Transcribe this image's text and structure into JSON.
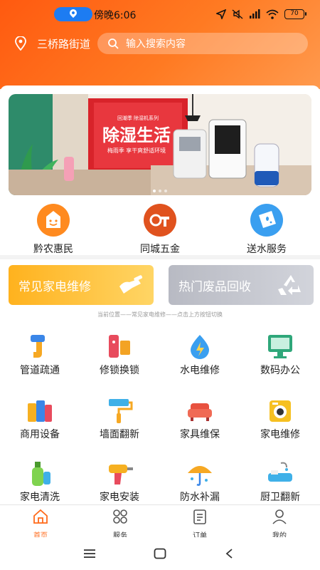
{
  "status": {
    "time": "傍晚6:06",
    "battery": "70"
  },
  "header": {
    "location": "三桥路街道",
    "search_placeholder": "输入搜索内容"
  },
  "banner": {
    "title": "除湿生活",
    "subtitle": "梅雨季 享干爽舒适环境",
    "series": "回潮季 除湿机系列"
  },
  "quick_actions": [
    {
      "label": "黔农惠民",
      "color": "#ff8a1f",
      "icon": "smiley-bag-icon"
    },
    {
      "label": "同城五金",
      "color": "#e0521e",
      "icon": "hardware-tools-icon"
    },
    {
      "label": "送水服务",
      "color": "#3a9ff0",
      "icon": "water-delivery-icon"
    }
  ],
  "cards": {
    "left": "常见家电维修",
    "right": "热门废品回收"
  },
  "hint": "当前位置——常见家电维修——点击上方按钮切换",
  "services": [
    {
      "label": "管道疏通",
      "icon": "pipe-icon"
    },
    {
      "label": "修锁换锁",
      "icon": "lock-icon"
    },
    {
      "label": "水电维修",
      "icon": "water-electric-icon"
    },
    {
      "label": "数码办公",
      "icon": "monitor-icon"
    },
    {
      "label": "商用设备",
      "icon": "commercial-equipment-icon"
    },
    {
      "label": "墙面翻新",
      "icon": "paint-roller-icon"
    },
    {
      "label": "家具维保",
      "icon": "sofa-icon"
    },
    {
      "label": "家电维修",
      "icon": "appliance-icon"
    },
    {
      "label": "家电清洗",
      "icon": "cleaning-bottle-icon"
    },
    {
      "label": "家电安装",
      "icon": "drill-icon"
    },
    {
      "label": "防水补漏",
      "icon": "umbrella-icon"
    },
    {
      "label": "厨卫翻新",
      "icon": "bathroom-icon"
    }
  ],
  "tabs": [
    {
      "label": "首页",
      "active": true
    },
    {
      "label": "服务",
      "active": false
    },
    {
      "label": "订单",
      "active": false
    },
    {
      "label": "我的",
      "active": false
    }
  ],
  "colors": {
    "accent": "#ff6a1a",
    "header_start": "#ff5a10",
    "header_end": "#ff9a4e",
    "card_orange": "#ffb21e",
    "card_gray": "#b8bac3"
  }
}
